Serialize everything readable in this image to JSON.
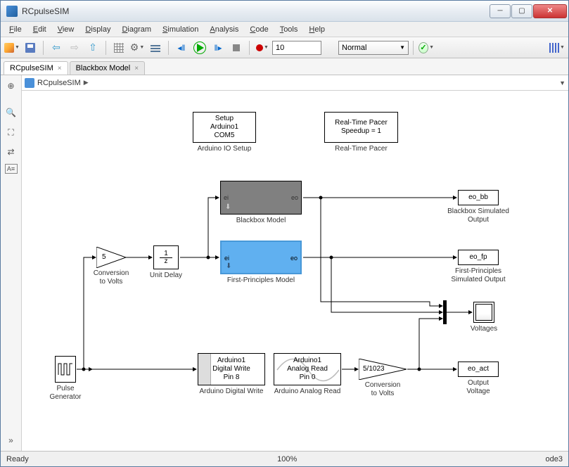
{
  "window": {
    "title": "RCpulseSIM"
  },
  "menubar": [
    "File",
    "Edit",
    "View",
    "Display",
    "Diagram",
    "Simulation",
    "Analysis",
    "Code",
    "Tools",
    "Help"
  ],
  "toolbar": {
    "sim_time": "10",
    "sim_mode": "Normal"
  },
  "tabs": [
    {
      "label": "RCpulseSIM",
      "active": true
    },
    {
      "label": "Blackbox Model",
      "active": false
    }
  ],
  "breadcrumb": {
    "model": "RCpulseSIM"
  },
  "blocks": {
    "setup": {
      "line1": "Setup",
      "line2": "Arduino1",
      "line3": "COM5",
      "label": "Arduino IO Setup"
    },
    "pacer": {
      "line1": "Real-Time Pacer",
      "line2": "Speedup = 1",
      "label": "Real-Time Pacer"
    },
    "blackbox": {
      "port_in": "ei",
      "port_out": "eo",
      "label": "Blackbox Model"
    },
    "fp": {
      "port_in": "ei",
      "port_out": "eo",
      "label": "First-Principles Model"
    },
    "gain1": {
      "value": "5",
      "label1": "Conversion",
      "label2": "to Volts"
    },
    "unitdelay": {
      "num": "1",
      "den": "z",
      "label": "Unit Delay"
    },
    "pulse": {
      "label1": "Pulse",
      "label2": "Generator"
    },
    "dwrite": {
      "line1": "Arduino1",
      "line2": "Digital Write",
      "line3": "Pin 8",
      "label": "Arduino Digital Write"
    },
    "aread": {
      "line1": "Arduino1",
      "line2": "Analog Read",
      "line3": "Pin 0",
      "label": "Arduino Analog Read"
    },
    "gain2": {
      "value": "5/1023",
      "label1": "Conversion",
      "label2": "to Volts"
    },
    "eo_bb": {
      "tag": "eo_bb",
      "label1": "Blackbox Simulated",
      "label2": "Output"
    },
    "eo_fp": {
      "tag": "eo_fp",
      "label1": "First-Principles",
      "label2": "Simulated Output"
    },
    "eo_act": {
      "tag": "eo_act",
      "label1": "Output",
      "label2": "Voltage"
    },
    "scope": {
      "label": "Voltages"
    }
  },
  "statusbar": {
    "left": "Ready",
    "zoom": "100%",
    "solver": "ode3"
  }
}
